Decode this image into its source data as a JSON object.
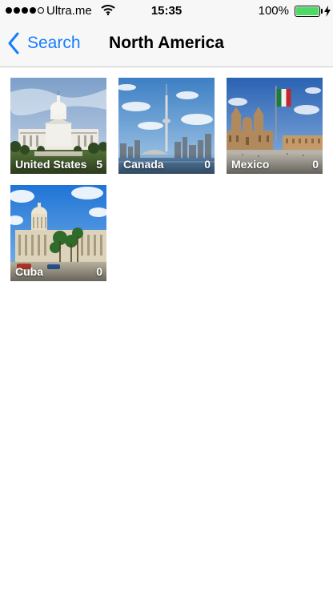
{
  "status_bar": {
    "carrier": "Ultra.me",
    "time": "15:35",
    "battery_percent": "100%",
    "signal_bars_filled": 4,
    "signal_bars_total": 5,
    "battery_level": 1.0,
    "battery_color": "#4cd964"
  },
  "nav_bar": {
    "back_label": "Search",
    "title": "North America",
    "accent_color": "#157efb"
  },
  "countries": [
    {
      "name": "United States",
      "count": "5",
      "photo": "capitol-building"
    },
    {
      "name": "Canada",
      "count": "0",
      "photo": "cn-tower-skyline"
    },
    {
      "name": "Mexico",
      "count": "0",
      "photo": "zocalo-cathedral-flag"
    },
    {
      "name": "Cuba",
      "count": "0",
      "photo": "havana-capitolio"
    }
  ]
}
